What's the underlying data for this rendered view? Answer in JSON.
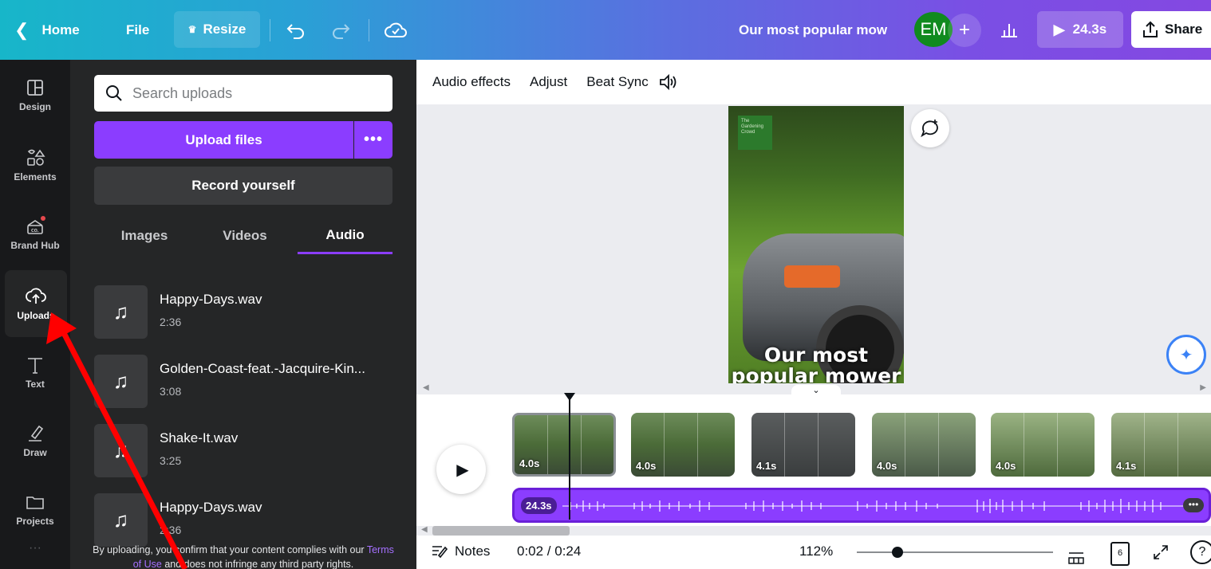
{
  "topbar": {
    "home_label": "Home",
    "file_label": "File",
    "resize_label": "Resize",
    "title": "Our most popular mow",
    "avatar_initials": "EM",
    "play_duration": "24.3s",
    "share_label": "Share"
  },
  "rail": {
    "items": [
      {
        "label": "Design",
        "icon": "layout-icon"
      },
      {
        "label": "Elements",
        "icon": "shapes-icon"
      },
      {
        "label": "Brand Hub",
        "icon": "brand-icon"
      },
      {
        "label": "Uploads",
        "icon": "cloud-upload-icon"
      },
      {
        "label": "Text",
        "icon": "text-icon"
      },
      {
        "label": "Draw",
        "icon": "pen-icon"
      },
      {
        "label": "Projects",
        "icon": "folder-icon"
      }
    ]
  },
  "panel": {
    "search_placeholder": "Search uploads",
    "upload_label": "Upload files",
    "upload_more": "•••",
    "record_label": "Record yourself",
    "tabs": [
      {
        "label": "Images",
        "active": false
      },
      {
        "label": "Videos",
        "active": false
      },
      {
        "label": "Audio",
        "active": true
      }
    ],
    "audio_items": [
      {
        "name": "Happy-Days.wav",
        "duration": "2:36"
      },
      {
        "name": "Golden-Coast-feat.-Jacquire-Kin...",
        "duration": "3:08"
      },
      {
        "name": "Shake-It.wav",
        "duration": "3:25"
      },
      {
        "name": "Happy-Days.wav",
        "duration": "2:36"
      }
    ],
    "disclaimer_prefix": "By uploading, you confirm that your content complies with our",
    "disclaimer_link": "Terms of Use",
    "disclaimer_suffix": "and does not infringe any third party rights."
  },
  "editor": {
    "toolbar": {
      "audio_effects": "Audio effects",
      "adjust": "Adjust",
      "beat_sync": "Beat Sync"
    },
    "video": {
      "brand_text": "The Gardening Crowd",
      "caption": "Our most popular mower"
    }
  },
  "timeline": {
    "clips": [
      {
        "duration": "4.0s",
        "selected": true
      },
      {
        "duration": "4.0s",
        "selected": false
      },
      {
        "duration": "4.1s",
        "selected": false
      },
      {
        "duration": "4.0s",
        "selected": false
      },
      {
        "duration": "4.0s",
        "selected": false
      },
      {
        "duration": "4.1s",
        "selected": false
      }
    ],
    "audio_length": "24.3s",
    "audio_more": "•••"
  },
  "bottombar": {
    "notes_label": "Notes",
    "time": "0:02 / 0:24",
    "zoom": "112%",
    "page_count": "6"
  },
  "colors": {
    "accent": "#8b3dff",
    "annotation_arrow": "#ff0000"
  }
}
